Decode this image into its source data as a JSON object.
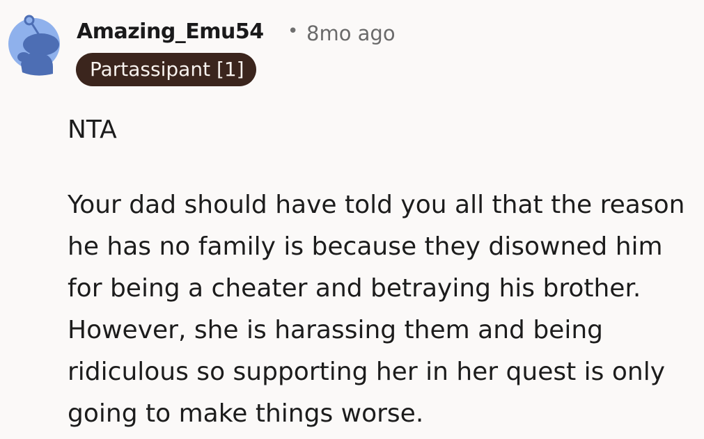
{
  "comment": {
    "author": "Amazing_Emu54",
    "separator": "•",
    "timestamp": "8mo ago",
    "flair": "Partassipant [1]",
    "avatar_icon": "snoo-avatar-icon",
    "verdict": "NTA",
    "body": "Your dad should have told you all that the reason he has no family is because they disowned him for being a cheater and betraying his brother. However, she is harassing them and being ridiculous so supporting her in her quest is only going to make things worse."
  },
  "colors": {
    "background": "#fbf9f8",
    "flair_background": "#3b251d",
    "flair_text": "#f7f2ee",
    "avatar_circle": "#8fb1ec",
    "avatar_figure": "#4d6eb4"
  }
}
